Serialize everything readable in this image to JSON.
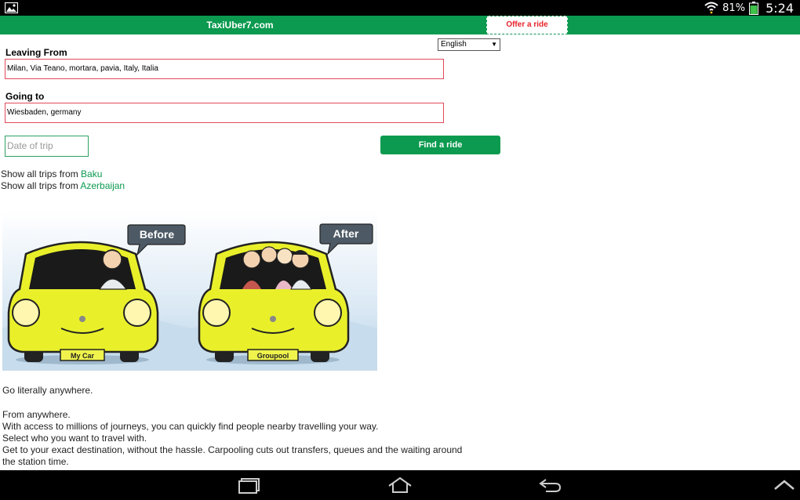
{
  "status_bar": {
    "battery_percent": "81%",
    "time": "5:24",
    "icons": [
      "image-icon",
      "wifi-icon",
      "battery-icon"
    ],
    "battery_level": 0.81
  },
  "header": {
    "site_title": "TaxiUber7.com",
    "offer_button": "Offer a ride",
    "brand_color": "#0b9a4f",
    "offer_color": "#e8222a"
  },
  "form": {
    "language": "English",
    "leaving_label": "Leaving From",
    "leaving_value": "Milan, Via Teano, mortara, pavia, Italy, Italia",
    "going_label": "Going to",
    "going_value": "Wiesbaden, germany",
    "date_placeholder": "Date of trip",
    "find_button": "Find a ride"
  },
  "trips": {
    "prefix": "Show all trips from ",
    "city": "Baku",
    "country": "Azerbaijan"
  },
  "illustration": {
    "before_label": "Before",
    "after_label": "After",
    "plate_left": "My Car",
    "plate_right": "Groupool"
  },
  "content": {
    "tagline": "Go literally anywhere.",
    "line1": "From anywhere.",
    "line2": "With access to millions of journeys, you can quickly find people nearby travelling your way.",
    "line3": "Select who you want to travel with.",
    "line4": "Get to your exact destination, without the hassle. Carpooling cuts out transfers, queues and the waiting around",
    "line5": "the station time."
  },
  "nav_bar": {
    "icons": [
      "recent-apps-icon",
      "home-icon",
      "back-icon",
      "chevron-up-icon"
    ]
  }
}
